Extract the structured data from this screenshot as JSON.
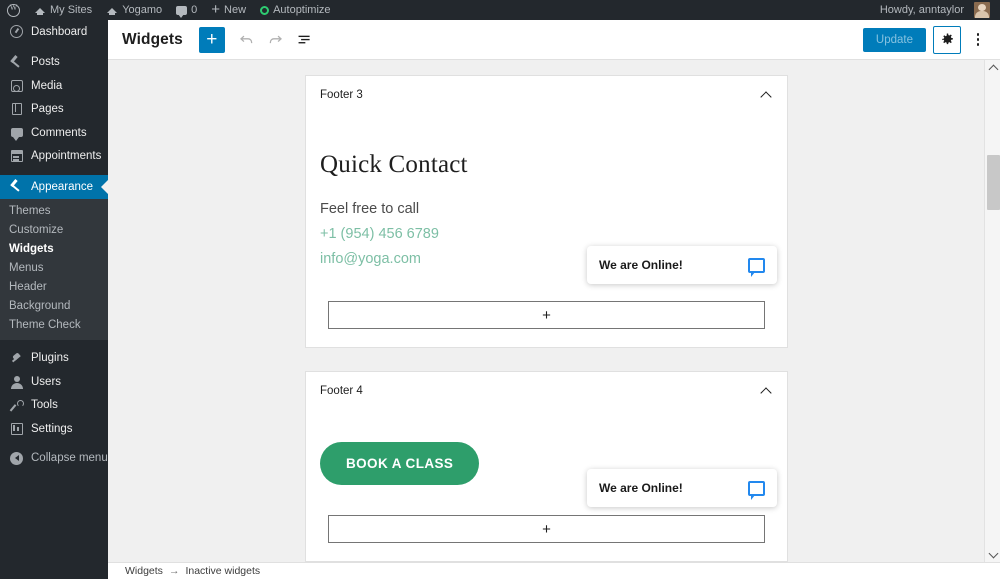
{
  "adminbar": {
    "items": [
      {
        "name": "wp-logo",
        "icon": "wordpress-icon",
        "label": ""
      },
      {
        "name": "my-sites",
        "icon": "sites-icon",
        "label": "My Sites"
      },
      {
        "name": "site-name",
        "icon": "site-icon",
        "label": "Yogamo"
      },
      {
        "name": "comments",
        "icon": "comment-bubble-icon",
        "label": "0"
      },
      {
        "name": "new-content",
        "icon": "plus-icon",
        "label": "New"
      },
      {
        "name": "autoptimize",
        "icon": "circle-dot-icon",
        "label": "Autoptimize"
      }
    ],
    "account_greeting": "Howdy, anntaylor"
  },
  "sidebar": {
    "items": [
      {
        "label": "Dashboard",
        "icon": "dashboard-icon",
        "current": false
      },
      {
        "label": "Posts",
        "icon": "pin-icon",
        "current": false
      },
      {
        "label": "Media",
        "icon": "media-icon",
        "current": false
      },
      {
        "label": "Pages",
        "icon": "pages-icon",
        "current": false
      },
      {
        "label": "Comments",
        "icon": "comment-icon",
        "current": false
      },
      {
        "label": "Appointments",
        "icon": "calendar-icon",
        "current": false
      },
      {
        "label": "Appearance",
        "icon": "appearance-icon",
        "current": true
      }
    ],
    "appearance_submenu": [
      {
        "label": "Themes",
        "current": false
      },
      {
        "label": "Customize",
        "current": false
      },
      {
        "label": "Widgets",
        "current": true
      },
      {
        "label": "Menus",
        "current": false
      },
      {
        "label": "Header",
        "current": false
      },
      {
        "label": "Background",
        "current": false
      },
      {
        "label": "Theme Check",
        "current": false
      }
    ],
    "items_bottom": [
      {
        "label": "Plugins",
        "icon": "plugin-icon",
        "current": false
      },
      {
        "label": "Users",
        "icon": "users-icon",
        "current": false
      },
      {
        "label": "Tools",
        "icon": "tools-icon",
        "current": false
      },
      {
        "label": "Settings",
        "icon": "settings-icon",
        "current": false
      }
    ],
    "collapse": {
      "label": "Collapse menu",
      "icon": "collapse-icon"
    }
  },
  "editor_header": {
    "title": "Widgets",
    "add_block_label": "+",
    "undo_label": "↩",
    "redo_label": "↪",
    "list_view_label": "≡",
    "update_label": "Update",
    "settings_label": "⚙",
    "more_label": "⋮"
  },
  "panels": [
    {
      "name": "footer-3",
      "title": "Footer 3",
      "heading": "Quick Contact",
      "paragraph": "Feel free to call",
      "phone": "+1 (954) 456 6789",
      "email": "info@yoga.com",
      "add_block": "+",
      "chat": {
        "text": "We are Online!",
        "icon": "chat-bubble-icon"
      }
    },
    {
      "name": "footer-4",
      "title": "Footer 4",
      "button_label": "BOOK A CLASS",
      "add_block": "+",
      "chat": {
        "text": "We are Online!",
        "icon": "chat-bubble-icon"
      }
    }
  ],
  "breadcrumb": {
    "root": "Widgets",
    "separator": "→",
    "current": "Inactive widgets"
  },
  "colors": {
    "admin_bar": "#23282d",
    "sidebar": "#23282d",
    "current_menu": "#0073aa",
    "accent_blue": "#007cba",
    "link_green": "#7dbfa5",
    "button_green": "#2e9e6b",
    "chat_icon_blue": "#2288ee",
    "canvas_bg": "#f0f0f0"
  }
}
